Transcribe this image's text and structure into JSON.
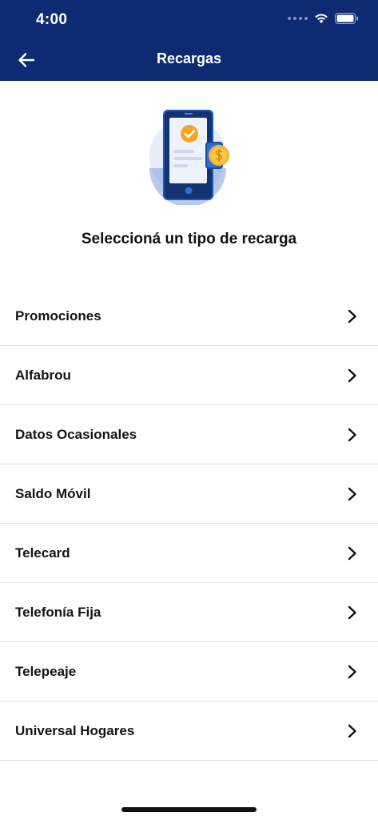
{
  "status_bar": {
    "time": "4:00"
  },
  "header": {
    "title": "Recargas"
  },
  "main": {
    "heading": "Seleccioná un tipo de recarga"
  },
  "options": [
    {
      "label": "Promociones"
    },
    {
      "label": "Alfabrou"
    },
    {
      "label": "Datos Ocasionales"
    },
    {
      "label": "Saldo Móvil"
    },
    {
      "label": "Telecard"
    },
    {
      "label": "Telefonía Fija"
    },
    {
      "label": "Telepeaje"
    },
    {
      "label": "Universal Hogares"
    }
  ],
  "icons": {
    "back": "back-arrow-icon",
    "chevron": "chevron-right-icon",
    "wifi": "wifi-icon",
    "battery": "battery-icon",
    "illustration": "phone-recharge-illustration"
  },
  "colors": {
    "header_bg": "#0d2a72",
    "accent_orange": "#f5a623",
    "coin_yellow": "#f7c948"
  }
}
